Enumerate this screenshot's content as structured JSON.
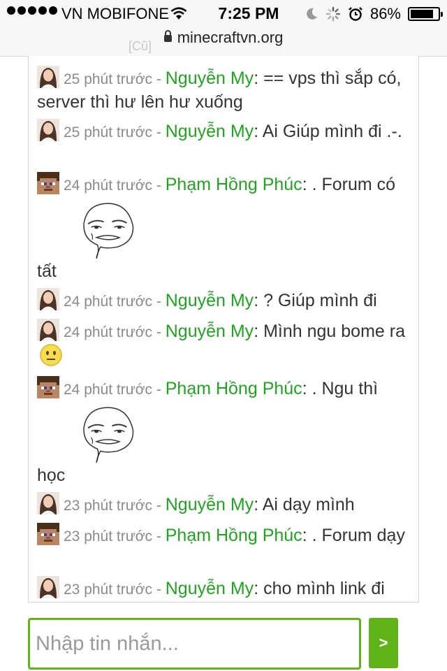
{
  "status_bar": {
    "carrier": "VN MOBIFONE",
    "time": "7:25 PM",
    "battery": "86%",
    "battery_level": 0.86
  },
  "browser": {
    "url": "minecraftvn.org",
    "ghost_tag": "[Cũ]"
  },
  "chat": {
    "separator": " - ",
    "messages": [
      {
        "time": "25 phút trước",
        "user": "Nguyễn My",
        "text": ": == vps thì sắp có, server thì hư lên hư xuống",
        "avatar": "girl-avatar-icon"
      },
      {
        "time": "25 phút trước",
        "user": "Nguyễn My",
        "text": ": Ai Giúp mình đi .-.",
        "avatar": "girl-avatar-icon"
      },
      {
        "time": "24 phút trước",
        "user": "Phạm Hồng Phúc",
        "text": ": . Forum có",
        "text_after": "tất",
        "avatar": "minecraft-steve-avatar-icon",
        "emoji": "are-you-serious-meme-icon"
      },
      {
        "time": "24 phút trước",
        "user": "Nguyễn My",
        "text": ": ? Giúp mình đi",
        "avatar": "girl-avatar-icon"
      },
      {
        "time": "24 phút trước",
        "user": "Nguyễn My",
        "text": ": Mình ngu bome ra",
        "avatar": "girl-avatar-icon",
        "emoji": "neutral-smiley-icon"
      },
      {
        "time": "24 phút trước",
        "user": "Phạm Hồng Phúc",
        "text": ": . Ngu thì",
        "text_after": "học",
        "avatar": "minecraft-steve-avatar-icon",
        "emoji": "are-you-serious-meme-icon"
      },
      {
        "time": "23 phút trước",
        "user": "Nguyễn My",
        "text": ": Ai dạy mình",
        "avatar": "girl-avatar-icon"
      },
      {
        "time": "23 phút trước",
        "user": "Phạm Hồng Phúc",
        "text": ": . Forum dạy",
        "avatar": "minecraft-steve-avatar-icon"
      },
      {
        "time": "23 phút trước",
        "user": "Nguyễn My",
        "text": ": cho mình link đi",
        "avatar": "girl-avatar-icon"
      }
    ]
  },
  "composer": {
    "placeholder": "Nhập tin nhắn...",
    "send_label": ">"
  },
  "colors": {
    "username": "#1fa51f",
    "accent": "#5fb318"
  }
}
